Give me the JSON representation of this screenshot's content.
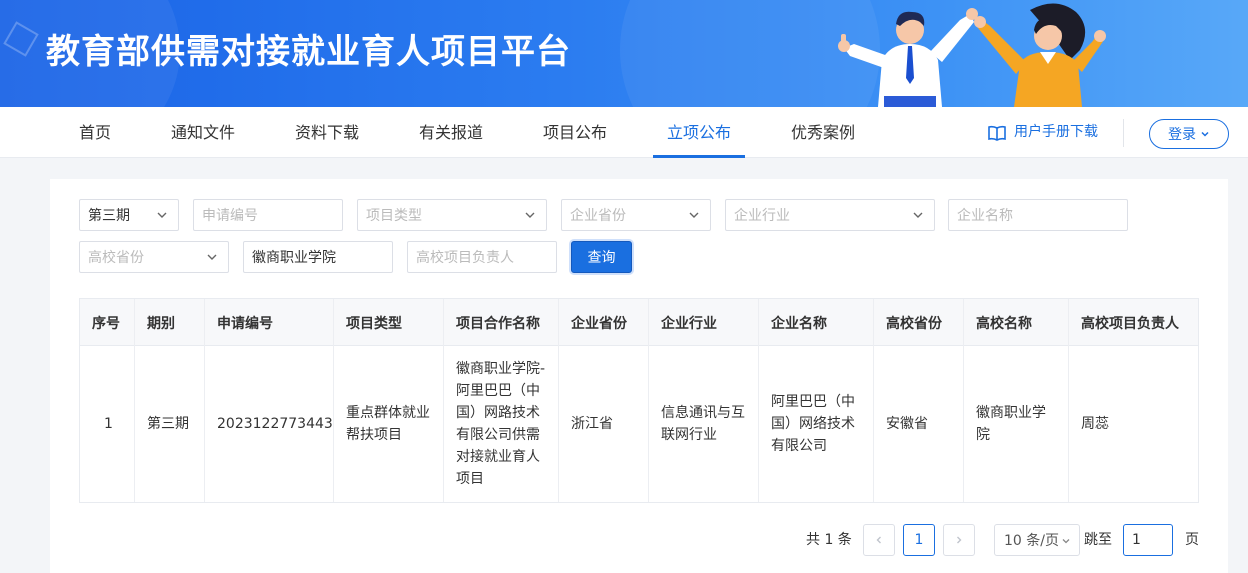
{
  "banner": {
    "title": "教育部供需对接就业育人项目平台"
  },
  "nav": {
    "items": [
      {
        "label": "首页"
      },
      {
        "label": "通知文件"
      },
      {
        "label": "资料下载"
      },
      {
        "label": "有关报道"
      },
      {
        "label": "项目公布"
      },
      {
        "label": "立项公布",
        "active": true
      },
      {
        "label": "优秀案例"
      }
    ],
    "manual_label": "用户手册下载",
    "login_label": "登录"
  },
  "filters": {
    "period": {
      "value": "第三期"
    },
    "application_no": {
      "placeholder": "申请编号"
    },
    "project_type": {
      "placeholder": "项目类型"
    },
    "company_province": {
      "placeholder": "企业省份"
    },
    "company_industry": {
      "placeholder": "企业行业"
    },
    "company_name": {
      "placeholder": "企业名称"
    },
    "college_province": {
      "placeholder": "高校省份"
    },
    "college_name": {
      "value": "徽商职业学院"
    },
    "college_leader": {
      "placeholder": "高校项目负责人"
    },
    "query_label": "查询"
  },
  "table": {
    "headers": [
      "序号",
      "期别",
      "申请编号",
      "项目类型",
      "项目合作名称",
      "企业省份",
      "企业行业",
      "企业名称",
      "高校省份",
      "高校名称",
      "高校项目负责人"
    ],
    "rows": [
      [
        "1",
        "第三期",
        "2023122773443",
        "重点群体就业帮扶项目",
        "徽商职业学院-阿里巴巴（中国）网路技术有限公司供需对接就业育人项目",
        "浙江省",
        "信息通讯与互联网行业",
        "阿里巴巴（中国）网络技术有限公司",
        "安徽省",
        "徽商职业学院",
        "周蕊"
      ]
    ]
  },
  "pagination": {
    "total_text": "共 1 条",
    "current_page": "1",
    "page_size": "10 条/页",
    "jump_label": "跳至",
    "jump_value": "1",
    "page_unit": "页"
  },
  "colors": {
    "accent": "#1a6fe0",
    "banner_start": "#1a63e6",
    "banner_end": "#58a8f8"
  }
}
